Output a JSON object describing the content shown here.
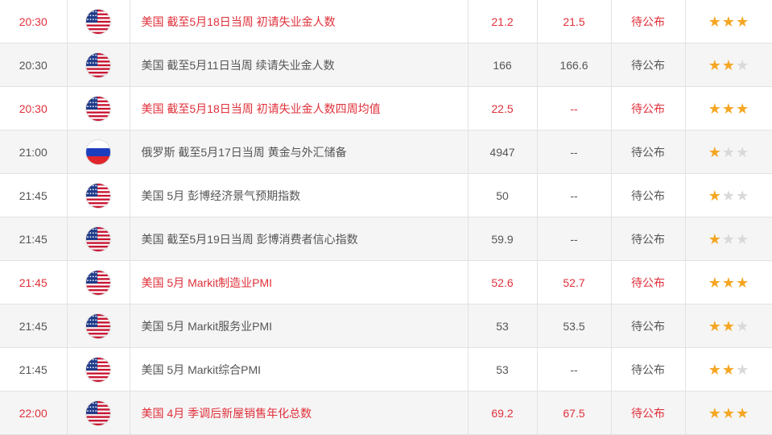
{
  "rows": [
    {
      "time": "20:30",
      "flag": "us-flag",
      "event": "美国 截至5月18日当周 初请失业金人数",
      "prev": "21.2",
      "forecast": "21.5",
      "actual": "待公布",
      "stars": 3,
      "highlight": true
    },
    {
      "time": "20:30",
      "flag": "us-flag",
      "event": "美国 截至5月11日当周 续请失业金人数",
      "prev": "166",
      "forecast": "166.6",
      "actual": "待公布",
      "stars": 2,
      "highlight": false
    },
    {
      "time": "20:30",
      "flag": "us-flag",
      "event": "美国 截至5月18日当周 初请失业金人数四周均值",
      "prev": "22.5",
      "forecast": "--",
      "actual": "待公布",
      "stars": 3,
      "highlight": true
    },
    {
      "time": "21:00",
      "flag": "ru-flag",
      "event": "俄罗斯 截至5月17日当周 黄金与外汇储备",
      "prev": "4947",
      "forecast": "--",
      "actual": "待公布",
      "stars": 1,
      "highlight": false
    },
    {
      "time": "21:45",
      "flag": "us-flag",
      "event": "美国 5月 彭博经济景气预期指数",
      "prev": "50",
      "forecast": "--",
      "actual": "待公布",
      "stars": 1,
      "highlight": false
    },
    {
      "time": "21:45",
      "flag": "us-flag",
      "event": "美国 截至5月19日当周 彭博消费者信心指数",
      "prev": "59.9",
      "forecast": "--",
      "actual": "待公布",
      "stars": 1,
      "highlight": false
    },
    {
      "time": "21:45",
      "flag": "us-flag",
      "event": "美国 5月 Markit制造业PMI",
      "prev": "52.6",
      "forecast": "52.7",
      "actual": "待公布",
      "stars": 3,
      "highlight": true
    },
    {
      "time": "21:45",
      "flag": "us-flag",
      "event": "美国 5月 Markit服务业PMI",
      "prev": "53",
      "forecast": "53.5",
      "actual": "待公布",
      "stars": 2,
      "highlight": false
    },
    {
      "time": "21:45",
      "flag": "us-flag",
      "event": "美国 5月 Markit综合PMI",
      "prev": "53",
      "forecast": "--",
      "actual": "待公布",
      "stars": 2,
      "highlight": false
    },
    {
      "time": "22:00",
      "flag": "us-flag",
      "event": "美国 4月 季调后新屋销售年化总数",
      "prev": "69.2",
      "forecast": "67.5",
      "actual": "待公布",
      "stars": 3,
      "highlight": true
    }
  ],
  "colors": {
    "highlight": "#e0303a",
    "text": "#555555",
    "star_on": "#f5a623",
    "star_off": "#d9d9d9"
  }
}
